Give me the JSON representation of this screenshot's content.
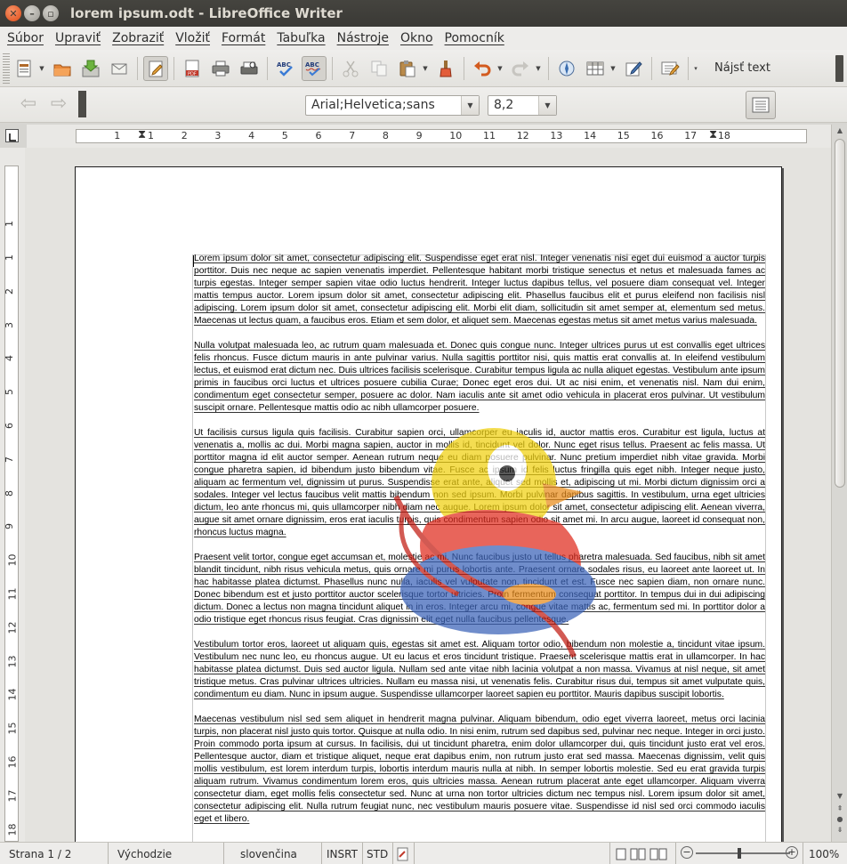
{
  "window": {
    "title": "lorem ipsum.odt - LibreOffice Writer"
  },
  "menu": [
    "Súbor",
    "Upraviť",
    "Zobraziť",
    "Vložiť",
    "Formát",
    "Tabuľka",
    "Nástroje",
    "Okno",
    "Pomocník"
  ],
  "toolbar": {
    "find_text": "Nájsť text",
    "font_name": "Arial;Helvetica;sans",
    "font_size": "8,2"
  },
  "ruler": {
    "horizontal": [
      "1",
      "1",
      "2",
      "3",
      "4",
      "5",
      "6",
      "7",
      "8",
      "9",
      "10",
      "11",
      "12",
      "13",
      "14",
      "15",
      "16",
      "17",
      "18"
    ],
    "vertical": [
      "1",
      "1",
      "2",
      "3",
      "4",
      "5",
      "6",
      "7",
      "8",
      "9",
      "10",
      "11",
      "12",
      "13",
      "14",
      "15",
      "16",
      "17",
      "18"
    ]
  },
  "document": {
    "paragraphs": [
      "Lorem ipsum dolor sit amet, consectetur adipiscing elit. Suspendisse eget erat nisl. Integer venenatis nisi eget dui euismod a auctor turpis porttitor. Duis nec neque ac sapien venenatis imperdiet. Pellentesque habitant morbi tristique senectus et netus et malesuada fames ac turpis egestas. Integer semper sapien vitae odio luctus hendrerit. Integer luctus dapibus tellus, vel posuere diam consequat vel. Integer mattis tempus auctor. Lorem ipsum dolor sit amet, consectetur adipiscing elit. Phasellus faucibus elit et purus eleifend non facilisis nisl adipiscing. Lorem ipsum dolor sit amet, consectetur adipiscing elit. Morbi elit diam, sollicitudin sit amet semper at, elementum sed metus. Maecenas ut lectus quam, a faucibus eros. Etiam et sem dolor, et aliquet sem. Maecenas egestas metus sit amet metus varius malesuada.",
      "Nulla volutpat malesuada leo, ac rutrum quam malesuada et. Donec quis congue nunc. Integer ultrices purus ut est convallis eget ultrices felis rhoncus. Fusce dictum mauris in ante pulvinar varius. Nulla sagittis porttitor nisi, quis mattis erat convallis at. In eleifend vestibulum lectus, et euismod erat dictum nec. Duis ultrices facilisis scelerisque. Curabitur tempus ligula ac nulla aliquet egestas. Vestibulum ante ipsum primis in faucibus orci luctus et ultrices posuere cubilia Curae; Donec eget eros dui. Ut ac nisi enim, et venenatis nisl. Nam dui enim, condimentum eget consectetur semper, posuere ac dolor. Nam iaculis ante sit amet odio vehicula in placerat eros pulvinar. Ut vestibulum suscipit ornare. Pellentesque mattis odio ac nibh ullamcorper posuere.",
      "Ut facilisis cursus ligula quis facilisis. Curabitur sapien orci, ullamcorper eu iaculis id, auctor mattis eros. Curabitur est ligula, luctus at venenatis a, mollis ac dui. Morbi magna sapien, auctor in mollis id, tincidunt vel dolor. Nunc eget risus tellus. Praesent ac felis massa. Ut porttitor magna id elit auctor semper. Aenean rutrum neque eu diam posuere pulvinar. Nunc pretium imperdiet nibh vitae gravida. Morbi congue pharetra sapien, id bibendum justo bibendum vitae. Fusce ac ipsum id felis luctus fringilla quis eget nibh. Integer neque justo, aliquam ac fermentum vel, dignissim ut purus. Suspendisse erat ante, aliquet sed mollis et, adipiscing ut mi. Morbi dictum dignissim orci a sodales. Integer vel lectus faucibus velit mattis bibendum non sed ipsum. Morbi pulvinar dapibus sagittis. In vestibulum, urna eget ultricies dictum, leo ante rhoncus mi, quis ullamcorper nibh diam nec augue. Lorem ipsum dolor sit amet, consectetur adipiscing elit. Aenean viverra, augue sit amet ornare dignissim, eros erat iaculis turpis, quis condimentum sapien odio sit amet mi. In arcu augue, laoreet id consequat non, rhoncus luctus magna.",
      "Praesent velit tortor, congue eget accumsan et, molestie ac mi. Nunc faucibus justo ut tellus pharetra malesuada. Sed faucibus, nibh sit amet blandit tincidunt, nibh risus vehicula metus, quis ornare mi purus lobortis ante. Praesent ornare sodales risus, eu laoreet ante laoreet ut. In hac habitasse platea dictumst. Phasellus nunc nulla, iaculis vel vulputate non, tincidunt et est. Fusce nec sapien diam, non ornare nunc. Donec bibendum est et justo porttitor auctor scelerisque tortor ultricies. Proin fermentum consequat porttitor. In tempus dui in dui adipiscing dictum. Donec a lectus non magna tincidunt aliquet in in eros. Integer arcu mi, congue vitae mattis ac, fermentum sed mi. In porttitor dolor a odio tristique eget rhoncus risus feugiat. Cras dignissim elit eget nulla faucibus pellentesque.",
      "Vestibulum tortor eros, laoreet ut aliquam quis, egestas sit amet est. Aliquam tortor odio, bibendum non molestie a, tincidunt vitae ipsum. Vestibulum nec nunc leo, eu rhoncus augue. Ut eu lacus et eros tincidunt tristique. Praesent scelerisque mattis erat in ullamcorper. In hac habitasse platea dictumst. Duis sed auctor ligula. Nullam sed ante vitae nibh lacinia volutpat a non massa. Vivamus at nisl neque, sit amet tristique metus. Cras pulvinar ultrices ultricies. Nullam eu massa nisi, ut venenatis felis. Curabitur risus dui, tempus sit amet vulputate quis, condimentum eu diam. Nunc in ipsum augue. Suspendisse ullamcorper laoreet sapien eu porttitor. Mauris dapibus suscipit lobortis.",
      "Maecenas vestibulum nisl sed sem aliquet in hendrerit magna pulvinar. Aliquam bibendum, odio eget viverra laoreet, metus orci lacinia turpis, non placerat nisl justo quis tortor. Quisque at nulla odio. In nisi enim, rutrum sed dapibus sed, pulvinar nec neque. Integer in orci justo. Proin commodo porta ipsum at cursus. In facilisis, dui ut tincidunt pharetra, enim dolor ullamcorper dui, quis tincidunt justo erat vel eros. Pellentesque auctor, diam et tristique aliquet, neque erat dapibus enim, non rutrum justo erat sed massa. Maecenas dignissim, velit quis mollis vestibulum, est lorem interdum turpis, lobortis interdum mauris nulla at nibh. In semper lobortis molestie. Sed eu erat gravida turpis aliquam rutrum. Vivamus condimentum lorem eros, quis ultricies massa. Aenean rutrum placerat ante eget ullamcorper. Aliquam viverra consectetur diam, eget mollis felis consectetur sed. Nunc at urna non tortor ultricies dictum nec tempus nisl. Lorem ipsum dolor sit amet, consectetur adipiscing elit. Nulla rutrum feugiat nunc, nec vestibulum mauris posuere vitae. Suspendisse id nisl sed orci commodo iaculis eget et libero."
    ]
  },
  "status": {
    "page": "Strana 1 / 2",
    "style": "Východzie",
    "language": "slovenčina",
    "insert_mode": "INSRT",
    "selection_mode": "STD",
    "zoom": "100%"
  },
  "icons": [
    "new-document-icon",
    "open-icon",
    "save-icon",
    "email-icon",
    "edit-mode-icon",
    "export-pdf-icon",
    "print-icon",
    "print-preview-icon",
    "spellcheck-icon",
    "autospellcheck-icon",
    "cut-icon",
    "copy-icon",
    "paste-icon",
    "clone-format-icon",
    "undo-icon",
    "redo-icon",
    "navigator-icon",
    "table-icon",
    "draw-icon",
    "form-controls-icon"
  ]
}
